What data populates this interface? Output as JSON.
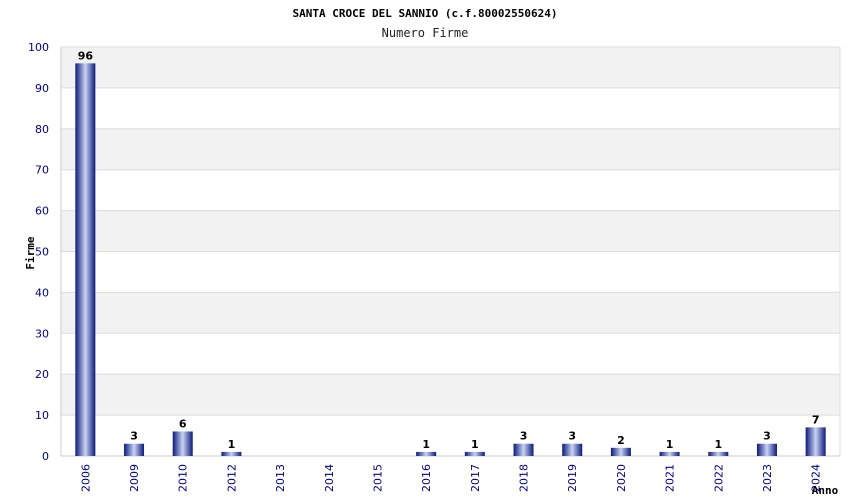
{
  "chart_data": {
    "type": "bar",
    "title": "SANTA CROCE DEL SANNIO (c.f.80002550624)",
    "subtitle": "Numero Firme",
    "xlabel": "Anno",
    "ylabel": "Firme",
    "ylim": [
      0,
      100
    ],
    "yticks": [
      0,
      10,
      20,
      30,
      40,
      50,
      60,
      70,
      80,
      90,
      100
    ],
    "grid": true,
    "categories": [
      "2006",
      "2009",
      "2010",
      "2012",
      "2013",
      "2014",
      "2015",
      "2016",
      "2017",
      "2018",
      "2019",
      "2020",
      "2021",
      "2022",
      "2023",
      "2024"
    ],
    "values": [
      96,
      3,
      6,
      1,
      null,
      null,
      null,
      1,
      1,
      3,
      3,
      2,
      1,
      1,
      3,
      7
    ],
    "colors": {
      "bar_dark": "#0a1a7a",
      "bar_light": "#c9d3f5",
      "band": "#f2f2f2",
      "tick": "#00008b"
    }
  }
}
